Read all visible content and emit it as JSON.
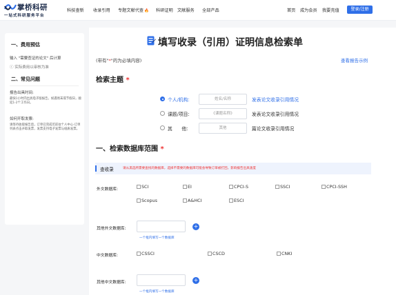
{
  "brand": {
    "name": "掌桥科研",
    "slogan": "一站式科研服务平台"
  },
  "nav": [
    {
      "label": "科技查新"
    },
    {
      "label": "收录引用"
    },
    {
      "label": "专题文献代查"
    },
    {
      "label": "科研证明"
    },
    {
      "label": "文献服务"
    },
    {
      "label": "全部产品"
    }
  ],
  "header_right": {
    "home": "首页",
    "member": "成为会员",
    "recharge": "我要充值",
    "login": "登录/注册"
  },
  "sidebar": {
    "fee_title": "一、费用预估",
    "fee_desc": "输入 \"需要查证的论文\" 后计算",
    "fee_note": "ⓘ 实际费用以审核为准",
    "faq_title": "二、常见问题",
    "q1": "报告出具时间:",
    "a1": "最快1小时内出具电子版报告，如遇周末或节假日，顺延1-2个工作日。",
    "q2": "如何开取发票:",
    "a2": "请等待收取报告后，订单已完成可前往个人中心-订单列表点击开取发票，发票支持电子发票与纸质发票。"
  },
  "page": {
    "title": "填写收录（引用）证明信息检索单",
    "note_prefix": "(带有\"",
    "note_star": "*",
    "note_suffix": "\"的为必填内容)",
    "sample_link": "查看报告示例"
  },
  "search_topic": {
    "heading": "检索主题",
    "star": "*",
    "options": [
      {
        "label": "个人/机构:",
        "placeholder": "姓名/名称",
        "desc": "发表论文收录引用情况",
        "selected": true
      },
      {
        "label": "课题/项目:",
        "placeholder": "《课题名称》",
        "desc": "发表论文收录引用情况",
        "selected": false
      },
      {
        "label": "其　　他:",
        "placeholder": "其他",
        "desc": "篇论文收录引用情况",
        "selected": false
      }
    ]
  },
  "db_scope": {
    "heading": "一、检索数据库范围",
    "star": "*",
    "tip_label": "查收录",
    "tip_text": "请从黑选所需要查找的数据库，选择不需要的数据库可能会导致订单被打回，影响报告出具速度",
    "foreign_label": "外文数据库:",
    "foreign": [
      "SCI",
      "EI",
      "CPCI-S",
      "SSCI",
      "CPCI-SSH",
      "Scopus",
      "A&HCI",
      "ESCI"
    ],
    "other_foreign_label": "其他外文数据库:",
    "hint_foreign": "一个框内填写一个数据库",
    "chinese_label": "中文数据库:",
    "chinese": [
      "CSSCI",
      "CSCD",
      "CNKI"
    ],
    "other_chinese_label": "其他中文数据库:",
    "hint_chinese": "一个框内填写一个数据库"
  },
  "colors": {
    "accent": "#2f6fe8",
    "required": "#e33333",
    "brand_dark": "#1c2b4a"
  }
}
